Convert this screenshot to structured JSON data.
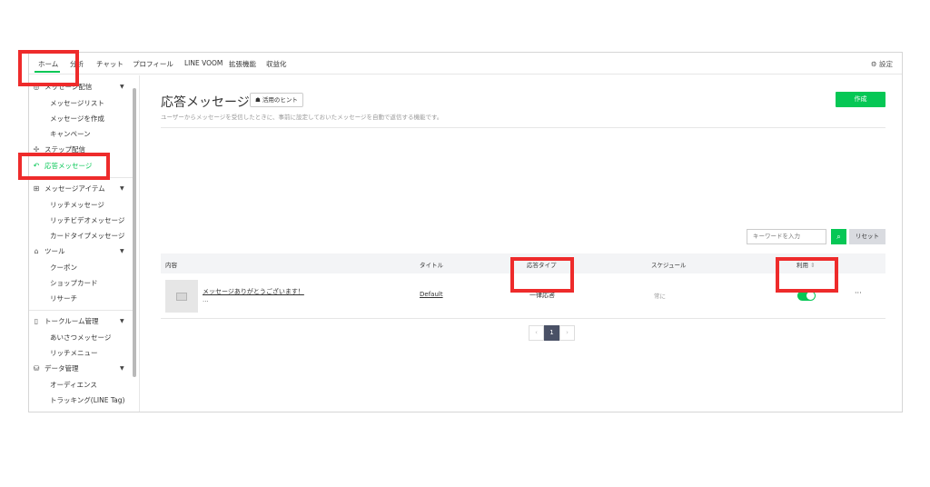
{
  "nav": {
    "items": [
      "ホーム",
      "分析",
      "チャット",
      "プロフィール",
      "LINE VOOM",
      "拡張機能",
      "収益化"
    ],
    "settings_label": "設定"
  },
  "sidebar": {
    "section_message": "メッセージ配信",
    "items_message": [
      "メッセージリスト",
      "メッセージを作成",
      "キャンペーン"
    ],
    "step": "ステップ配信",
    "auto_reply": "応答メッセージ",
    "section_items": "メッセージアイテム",
    "items_items": [
      "リッチメッセージ",
      "リッチビデオメッセージ",
      "カードタイプメッセージ"
    ],
    "section_tools": "ツール",
    "items_tools": [
      "クーポン",
      "ショップカード",
      "リサーチ"
    ],
    "section_chatroom": "トークルーム管理",
    "items_chatroom": [
      "あいさつメッセージ",
      "リッチメニュー"
    ],
    "section_data": "データ管理",
    "items_data": [
      "オーディエンス",
      "トラッキング(LINE Tag)"
    ]
  },
  "main": {
    "title": "応答メッセージ",
    "hint_label": "活用のヒント",
    "subtitle": "ユーザーからメッセージを受信したときに、事前に設定しておいたメッセージを自動で返信する機能です。",
    "create_label": "作成",
    "search_placeholder": "キーワードを入力",
    "reset_label": "リセット",
    "columns": {
      "content": "内容",
      "title": "タイトル",
      "type": "応答タイプ",
      "schedule": "スケジュール",
      "use": "利用"
    },
    "row": {
      "message": "メッセージありがとうございます！",
      "sub": "...",
      "title": "Default",
      "type": "一律応答",
      "schedule": "常に",
      "enabled": true
    },
    "pager": {
      "prev": "‹",
      "current": "1",
      "next": "›"
    }
  },
  "colors": {
    "accent": "#06c755",
    "annotation": "#ee2b2b",
    "pager_active": "#4a5166"
  }
}
